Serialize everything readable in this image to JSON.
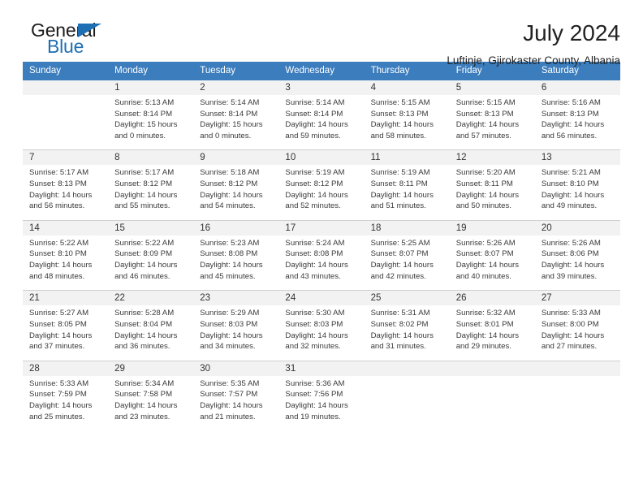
{
  "brand": {
    "name_part1": "General",
    "name_part2": "Blue",
    "triangle_icon": "triangle-icon",
    "accent_color": "#1f6fb5"
  },
  "header": {
    "title": "July 2024",
    "subtitle": "Luftinje, Gjirokaster County, Albania"
  },
  "colors": {
    "header_row_bg": "#3b7dbd",
    "daynum_row_bg": "#f2f2f2",
    "cell_bg": "#ffffff",
    "text": "#3a3a3a"
  },
  "calendar": {
    "weekday_headers": [
      "Sunday",
      "Monday",
      "Tuesday",
      "Wednesday",
      "Thursday",
      "Friday",
      "Saturday"
    ],
    "weeks": [
      {
        "days": [
          {
            "num": "",
            "sunrise": "",
            "sunset": "",
            "daylight_line1": "",
            "daylight_line2": ""
          },
          {
            "num": "1",
            "sunrise": "Sunrise: 5:13 AM",
            "sunset": "Sunset: 8:14 PM",
            "daylight_line1": "Daylight: 15 hours",
            "daylight_line2": "and 0 minutes."
          },
          {
            "num": "2",
            "sunrise": "Sunrise: 5:14 AM",
            "sunset": "Sunset: 8:14 PM",
            "daylight_line1": "Daylight: 15 hours",
            "daylight_line2": "and 0 minutes."
          },
          {
            "num": "3",
            "sunrise": "Sunrise: 5:14 AM",
            "sunset": "Sunset: 8:14 PM",
            "daylight_line1": "Daylight: 14 hours",
            "daylight_line2": "and 59 minutes."
          },
          {
            "num": "4",
            "sunrise": "Sunrise: 5:15 AM",
            "sunset": "Sunset: 8:13 PM",
            "daylight_line1": "Daylight: 14 hours",
            "daylight_line2": "and 58 minutes."
          },
          {
            "num": "5",
            "sunrise": "Sunrise: 5:15 AM",
            "sunset": "Sunset: 8:13 PM",
            "daylight_line1": "Daylight: 14 hours",
            "daylight_line2": "and 57 minutes."
          },
          {
            "num": "6",
            "sunrise": "Sunrise: 5:16 AM",
            "sunset": "Sunset: 8:13 PM",
            "daylight_line1": "Daylight: 14 hours",
            "daylight_line2": "and 56 minutes."
          }
        ]
      },
      {
        "days": [
          {
            "num": "7",
            "sunrise": "Sunrise: 5:17 AM",
            "sunset": "Sunset: 8:13 PM",
            "daylight_line1": "Daylight: 14 hours",
            "daylight_line2": "and 56 minutes."
          },
          {
            "num": "8",
            "sunrise": "Sunrise: 5:17 AM",
            "sunset": "Sunset: 8:12 PM",
            "daylight_line1": "Daylight: 14 hours",
            "daylight_line2": "and 55 minutes."
          },
          {
            "num": "9",
            "sunrise": "Sunrise: 5:18 AM",
            "sunset": "Sunset: 8:12 PM",
            "daylight_line1": "Daylight: 14 hours",
            "daylight_line2": "and 54 minutes."
          },
          {
            "num": "10",
            "sunrise": "Sunrise: 5:19 AM",
            "sunset": "Sunset: 8:12 PM",
            "daylight_line1": "Daylight: 14 hours",
            "daylight_line2": "and 52 minutes."
          },
          {
            "num": "11",
            "sunrise": "Sunrise: 5:19 AM",
            "sunset": "Sunset: 8:11 PM",
            "daylight_line1": "Daylight: 14 hours",
            "daylight_line2": "and 51 minutes."
          },
          {
            "num": "12",
            "sunrise": "Sunrise: 5:20 AM",
            "sunset": "Sunset: 8:11 PM",
            "daylight_line1": "Daylight: 14 hours",
            "daylight_line2": "and 50 minutes."
          },
          {
            "num": "13",
            "sunrise": "Sunrise: 5:21 AM",
            "sunset": "Sunset: 8:10 PM",
            "daylight_line1": "Daylight: 14 hours",
            "daylight_line2": "and 49 minutes."
          }
        ]
      },
      {
        "days": [
          {
            "num": "14",
            "sunrise": "Sunrise: 5:22 AM",
            "sunset": "Sunset: 8:10 PM",
            "daylight_line1": "Daylight: 14 hours",
            "daylight_line2": "and 48 minutes."
          },
          {
            "num": "15",
            "sunrise": "Sunrise: 5:22 AM",
            "sunset": "Sunset: 8:09 PM",
            "daylight_line1": "Daylight: 14 hours",
            "daylight_line2": "and 46 minutes."
          },
          {
            "num": "16",
            "sunrise": "Sunrise: 5:23 AM",
            "sunset": "Sunset: 8:08 PM",
            "daylight_line1": "Daylight: 14 hours",
            "daylight_line2": "and 45 minutes."
          },
          {
            "num": "17",
            "sunrise": "Sunrise: 5:24 AM",
            "sunset": "Sunset: 8:08 PM",
            "daylight_line1": "Daylight: 14 hours",
            "daylight_line2": "and 43 minutes."
          },
          {
            "num": "18",
            "sunrise": "Sunrise: 5:25 AM",
            "sunset": "Sunset: 8:07 PM",
            "daylight_line1": "Daylight: 14 hours",
            "daylight_line2": "and 42 minutes."
          },
          {
            "num": "19",
            "sunrise": "Sunrise: 5:26 AM",
            "sunset": "Sunset: 8:07 PM",
            "daylight_line1": "Daylight: 14 hours",
            "daylight_line2": "and 40 minutes."
          },
          {
            "num": "20",
            "sunrise": "Sunrise: 5:26 AM",
            "sunset": "Sunset: 8:06 PM",
            "daylight_line1": "Daylight: 14 hours",
            "daylight_line2": "and 39 minutes."
          }
        ]
      },
      {
        "days": [
          {
            "num": "21",
            "sunrise": "Sunrise: 5:27 AM",
            "sunset": "Sunset: 8:05 PM",
            "daylight_line1": "Daylight: 14 hours",
            "daylight_line2": "and 37 minutes."
          },
          {
            "num": "22",
            "sunrise": "Sunrise: 5:28 AM",
            "sunset": "Sunset: 8:04 PM",
            "daylight_line1": "Daylight: 14 hours",
            "daylight_line2": "and 36 minutes."
          },
          {
            "num": "23",
            "sunrise": "Sunrise: 5:29 AM",
            "sunset": "Sunset: 8:03 PM",
            "daylight_line1": "Daylight: 14 hours",
            "daylight_line2": "and 34 minutes."
          },
          {
            "num": "24",
            "sunrise": "Sunrise: 5:30 AM",
            "sunset": "Sunset: 8:03 PM",
            "daylight_line1": "Daylight: 14 hours",
            "daylight_line2": "and 32 minutes."
          },
          {
            "num": "25",
            "sunrise": "Sunrise: 5:31 AM",
            "sunset": "Sunset: 8:02 PM",
            "daylight_line1": "Daylight: 14 hours",
            "daylight_line2": "and 31 minutes."
          },
          {
            "num": "26",
            "sunrise": "Sunrise: 5:32 AM",
            "sunset": "Sunset: 8:01 PM",
            "daylight_line1": "Daylight: 14 hours",
            "daylight_line2": "and 29 minutes."
          },
          {
            "num": "27",
            "sunrise": "Sunrise: 5:33 AM",
            "sunset": "Sunset: 8:00 PM",
            "daylight_line1": "Daylight: 14 hours",
            "daylight_line2": "and 27 minutes."
          }
        ]
      },
      {
        "days": [
          {
            "num": "28",
            "sunrise": "Sunrise: 5:33 AM",
            "sunset": "Sunset: 7:59 PM",
            "daylight_line1": "Daylight: 14 hours",
            "daylight_line2": "and 25 minutes."
          },
          {
            "num": "29",
            "sunrise": "Sunrise: 5:34 AM",
            "sunset": "Sunset: 7:58 PM",
            "daylight_line1": "Daylight: 14 hours",
            "daylight_line2": "and 23 minutes."
          },
          {
            "num": "30",
            "sunrise": "Sunrise: 5:35 AM",
            "sunset": "Sunset: 7:57 PM",
            "daylight_line1": "Daylight: 14 hours",
            "daylight_line2": "and 21 minutes."
          },
          {
            "num": "31",
            "sunrise": "Sunrise: 5:36 AM",
            "sunset": "Sunset: 7:56 PM",
            "daylight_line1": "Daylight: 14 hours",
            "daylight_line2": "and 19 minutes."
          },
          {
            "num": "",
            "sunrise": "",
            "sunset": "",
            "daylight_line1": "",
            "daylight_line2": ""
          },
          {
            "num": "",
            "sunrise": "",
            "sunset": "",
            "daylight_line1": "",
            "daylight_line2": ""
          },
          {
            "num": "",
            "sunrise": "",
            "sunset": "",
            "daylight_line1": "",
            "daylight_line2": ""
          }
        ]
      }
    ]
  }
}
